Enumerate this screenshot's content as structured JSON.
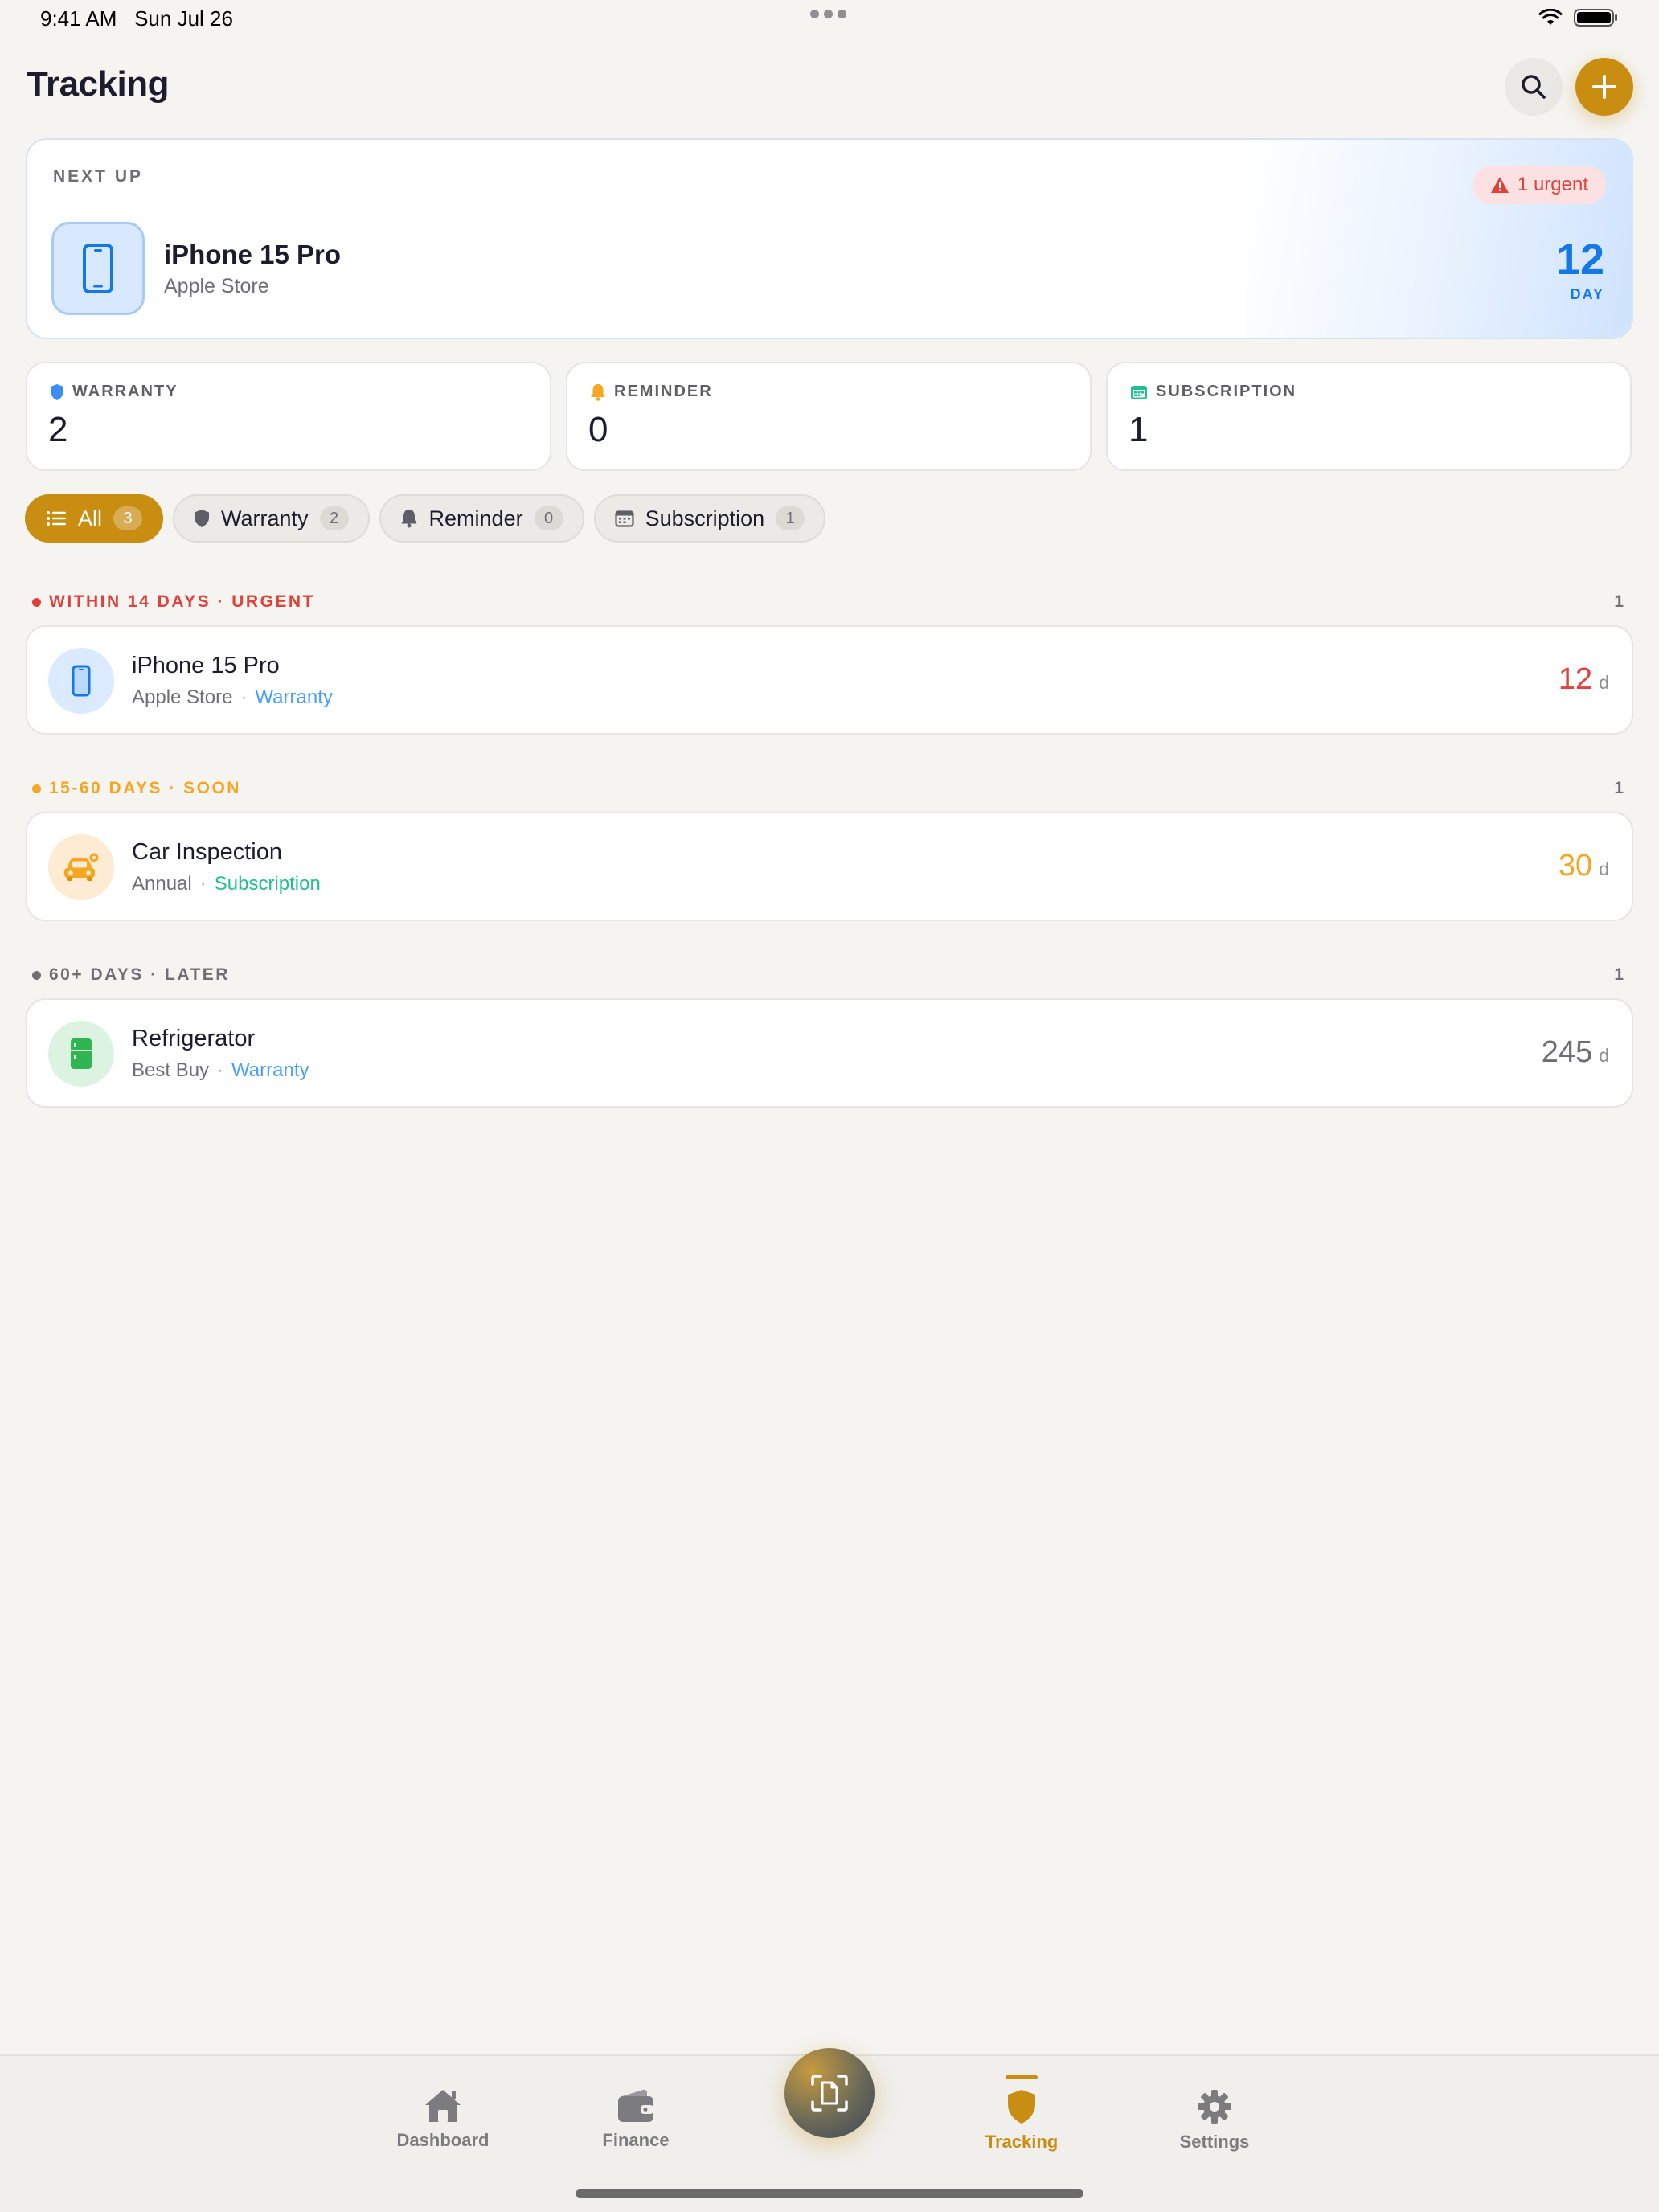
{
  "status_bar": {
    "time": "9:41 AM",
    "date": "Sun Jul 26"
  },
  "header": {
    "title": "Tracking"
  },
  "next_up": {
    "label": "NEXT UP",
    "urgent_badge": "1 urgent",
    "title": "iPhone 15 Pro",
    "subtitle": "Apple Store",
    "days": "12",
    "unit": "DAY",
    "icon": "iphone-icon"
  },
  "stats": [
    {
      "label": "WARRANTY",
      "value": "2",
      "icon": "shield-icon",
      "color": "#3b8ff0"
    },
    {
      "label": "REMINDER",
      "value": "0",
      "icon": "bell-icon",
      "color": "#f5a623"
    },
    {
      "label": "SUBSCRIPTION",
      "value": "1",
      "icon": "calendar-icon",
      "color": "#1fbf8f"
    }
  ],
  "filters": [
    {
      "label": "All",
      "count": "3",
      "active": true
    },
    {
      "label": "Warranty",
      "count": "2"
    },
    {
      "label": "Reminder",
      "count": "0"
    },
    {
      "label": "Subscription",
      "count": "1"
    }
  ],
  "sections": [
    {
      "header": "WITHIN 14 DAYS · URGENT",
      "count": "1",
      "color": "#e0413a",
      "items": [
        {
          "title": "iPhone 15 Pro",
          "source": "Apple Store",
          "category": "Warranty",
          "category_color": "#4a9ff5",
          "days": "12",
          "unit": "d",
          "days_color": "#e0413a",
          "icon": "iphone-icon"
        }
      ]
    },
    {
      "header": "15-60 DAYS · SOON",
      "count": "1",
      "color": "#f5a623",
      "items": [
        {
          "title": "Car Inspection",
          "source": "Annual",
          "category": "Subscription",
          "category_color": "#1fbf8f",
          "days": "30",
          "unit": "d",
          "days_color": "#f5a623",
          "icon": "car-icon"
        }
      ]
    },
    {
      "header": "60+ DAYS · LATER",
      "count": "1",
      "color": "#6e6e73",
      "items": [
        {
          "title": "Refrigerator",
          "source": "Best Buy",
          "category": "Warranty",
          "category_color": "#4a9ff5",
          "days": "245",
          "unit": "d",
          "days_color": "#6e6e73",
          "icon": "refrigerator-icon"
        }
      ]
    }
  ],
  "tabs": [
    {
      "label": "Dashboard",
      "icon": "house-icon"
    },
    {
      "label": "Finance",
      "icon": "wallet-icon"
    },
    {
      "label": "Tracking",
      "icon": "shield-icon",
      "active": true
    },
    {
      "label": "Settings",
      "icon": "gear-icon"
    }
  ],
  "scan_button": {
    "icon": "scan-document-icon"
  }
}
